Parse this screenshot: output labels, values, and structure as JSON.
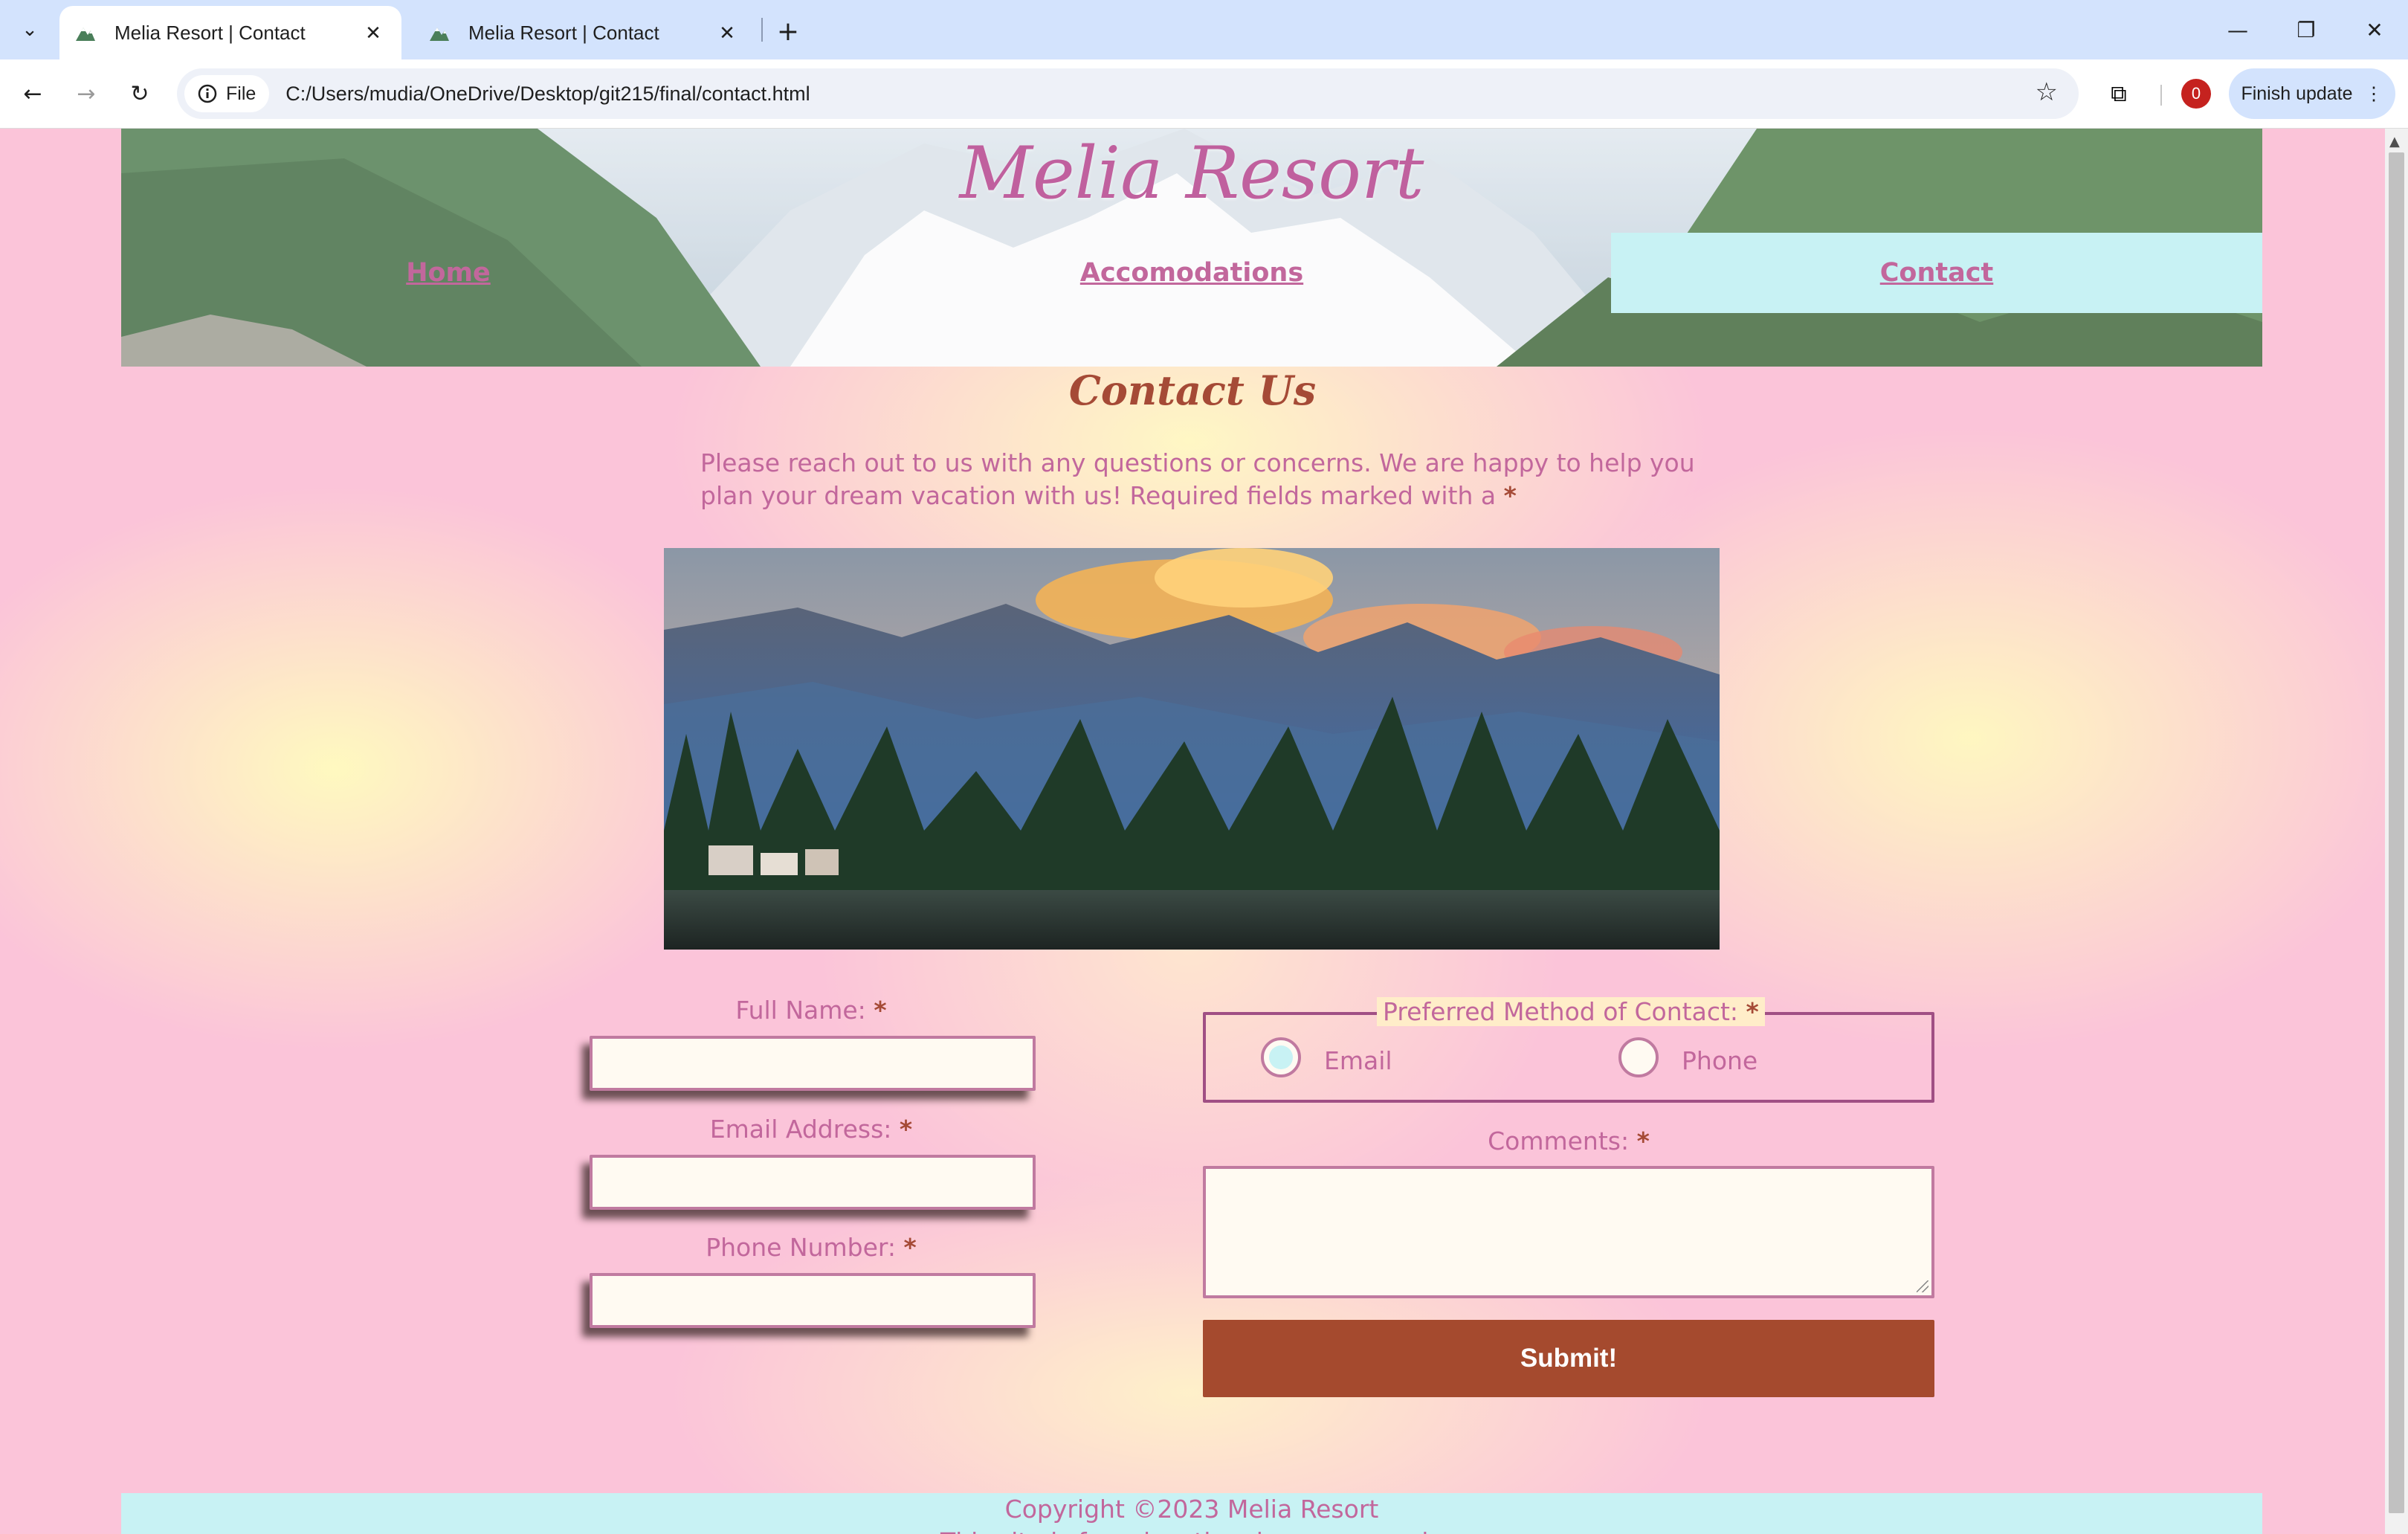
{
  "browser": {
    "tabs": [
      {
        "title": "Melia Resort | Contact",
        "active": true
      },
      {
        "title": "Melia Resort | Contact",
        "active": false
      }
    ],
    "address": {
      "scheme_label": "File",
      "url": "C:/Users/mudia/OneDrive/Desktop/git215/final/contact.html"
    },
    "profile_badge": "0",
    "update_button": "Finish update"
  },
  "site": {
    "title": "Melia Resort",
    "nav": [
      {
        "label": "Home",
        "active": false
      },
      {
        "label": "Accomodations",
        "active": false
      },
      {
        "label": "Contact",
        "active": true
      }
    ]
  },
  "contact": {
    "heading": "Contact Us",
    "intro": "Please reach out to us with any questions or concerns. We are happy to help you plan your dream vacation with us! Required fields marked with a",
    "required_marker": "*",
    "form": {
      "full_name_label": "Full Name:",
      "email_label": "Email Address:",
      "phone_label": "Phone Number:",
      "contact_method_legend": "Preferred Method of Contact:",
      "contact_methods": [
        {
          "label": "Email",
          "checked": true
        },
        {
          "label": "Phone",
          "checked": false
        }
      ],
      "comments_label": "Comments:",
      "submit_label": "Submit!"
    }
  },
  "footer": {
    "copyright": "Copyright ©2023 Melia Resort",
    "line2": "This site is for educational purposes only"
  },
  "colors": {
    "accent_pink": "#c2679c",
    "heading_rust": "#a54a36",
    "nav_active": "#c8f2f4",
    "submit_bg": "#a54a2e"
  }
}
